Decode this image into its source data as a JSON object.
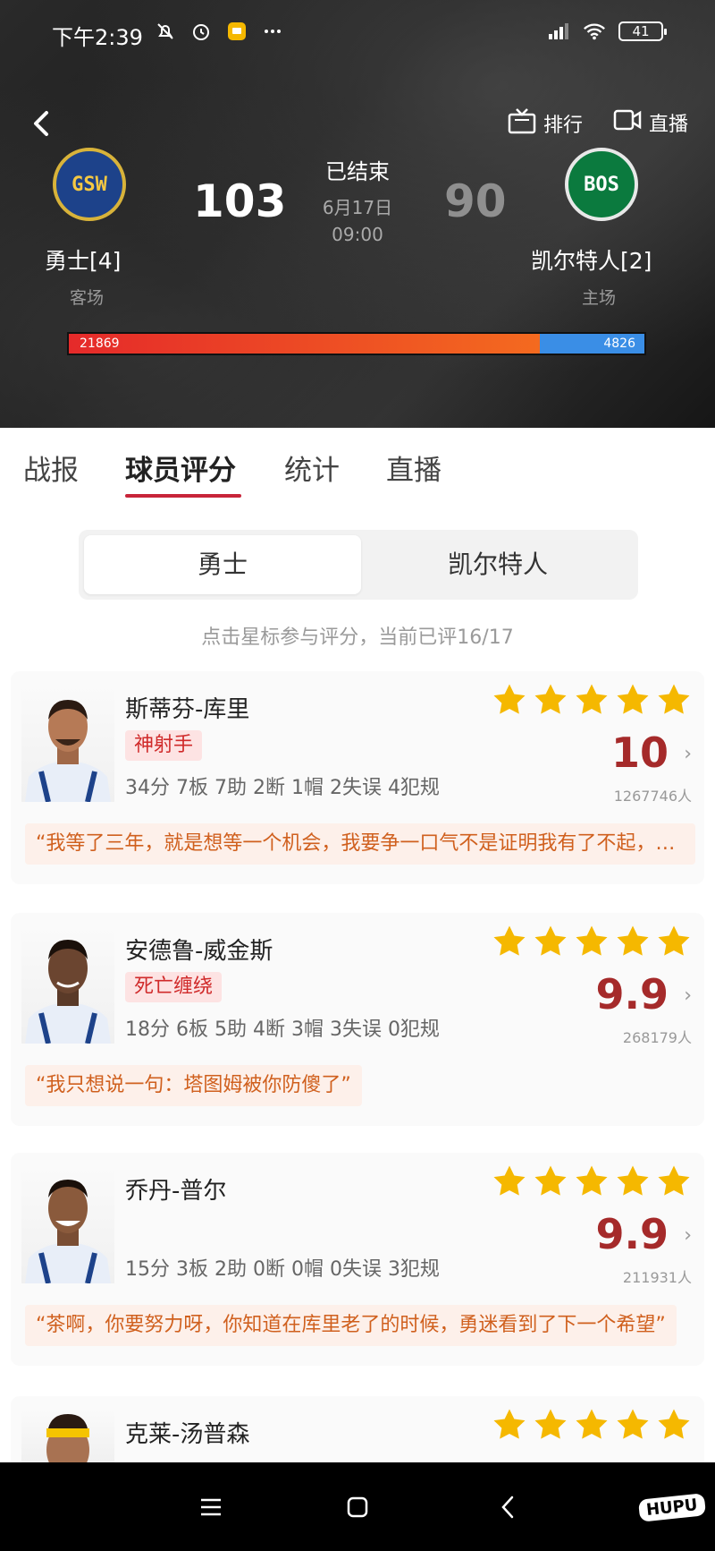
{
  "status_bar": {
    "time": "下午2:39",
    "battery": "41"
  },
  "header": {
    "ranking_label": "排行",
    "live_label": "直播",
    "home_team": {
      "abbr": "GSW",
      "name": "勇士[4]",
      "side": "客场",
      "score": "103",
      "support": "21869",
      "color": "#1d428a"
    },
    "away_team": {
      "abbr": "BOS",
      "name": "凯尔特人[2]",
      "side": "主场",
      "score": "90",
      "support": "4826",
      "color": "#0b7a3e"
    },
    "game_status": "已结束",
    "game_date": "6月17日",
    "game_time": "09:00",
    "support_share_left": 0.819
  },
  "tabs": [
    {
      "label": "战报"
    },
    {
      "label": "球员评分",
      "active": true
    },
    {
      "label": "统计"
    },
    {
      "label": "直播"
    }
  ],
  "team_toggle": {
    "active": "勇士",
    "inactive": "凯尔特人"
  },
  "hint": "点击星标参与评分，当前已评16/17",
  "players": [
    {
      "name": "斯蒂芬-库里",
      "tag": "神射手",
      "stats": "34分 7板 7助 2断 1帽 2失误 4犯规",
      "rating": "10",
      "voters": "1267746人",
      "stars": 5,
      "comment": "“我等了三年，就是想等一个机会，我要争一口气不是证明我有了不起，我是要告诉人家，我失去的东西我一定要拿回来！”"
    },
    {
      "name": "安德鲁-威金斯",
      "tag": "死亡缠绕",
      "stats": "18分 6板 5助 4断 3帽 3失误 0犯规",
      "rating": "9.9",
      "voters": "268179人",
      "stars": 5,
      "comment": "“我只想说一句：塔图姆被你防傻了”"
    },
    {
      "name": "乔丹-普尔",
      "tag": "",
      "stats": "15分 3板 2助 0断 0帽 0失误 3犯规",
      "rating": "9.9",
      "voters": "211931人",
      "stars": 5,
      "comment": "“茶啊，你要努力呀，你知道在库里老了的时候，勇迷看到了下一个希望”"
    },
    {
      "name": "克莱-汤普森",
      "stars": 5
    }
  ],
  "colors": {
    "accent": "#c8253a",
    "rating": "#a52a2a",
    "star": "#f5b800",
    "comment_text": "#d0601e"
  },
  "watermark": "HUPU"
}
